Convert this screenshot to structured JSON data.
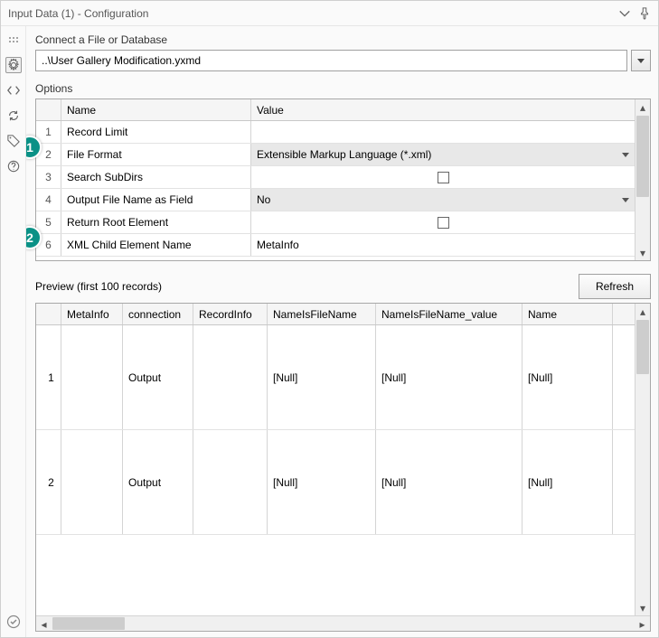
{
  "title": "Input Data (1) - Configuration",
  "connect": {
    "label": "Connect a File or Database",
    "path": "..\\User Gallery Modification.yxmd"
  },
  "options": {
    "label": "Options",
    "headers": {
      "name": "Name",
      "value": "Value"
    },
    "rows": [
      {
        "num": "1",
        "name": "Record Limit",
        "type": "blank"
      },
      {
        "num": "2",
        "name": "File Format",
        "type": "select",
        "value": "Extensible Markup Language (*.xml)"
      },
      {
        "num": "3",
        "name": "Search SubDirs",
        "type": "check"
      },
      {
        "num": "4",
        "name": "Output File Name as Field",
        "type": "select",
        "value": "No"
      },
      {
        "num": "5",
        "name": "Return Root Element",
        "type": "check"
      },
      {
        "num": "6",
        "name": "XML Child Element Name",
        "type": "text",
        "value": "MetaInfo"
      }
    ]
  },
  "preview": {
    "label": "Preview (first 100 records)",
    "refresh": "Refresh",
    "headers": [
      "",
      "MetaInfo",
      "connection",
      "RecordInfo",
      "NameIsFileName",
      "NameIsFileName_value",
      "Name"
    ],
    "rows": [
      {
        "num": "1",
        "cells": [
          "",
          "Output",
          "",
          "[Null]",
          "[Null]",
          "[Null]"
        ]
      },
      {
        "num": "2",
        "cells": [
          "",
          "Output",
          "",
          "[Null]",
          "[Null]",
          "[Null]"
        ]
      }
    ]
  },
  "callouts": {
    "c1": "1",
    "c2": "2"
  }
}
